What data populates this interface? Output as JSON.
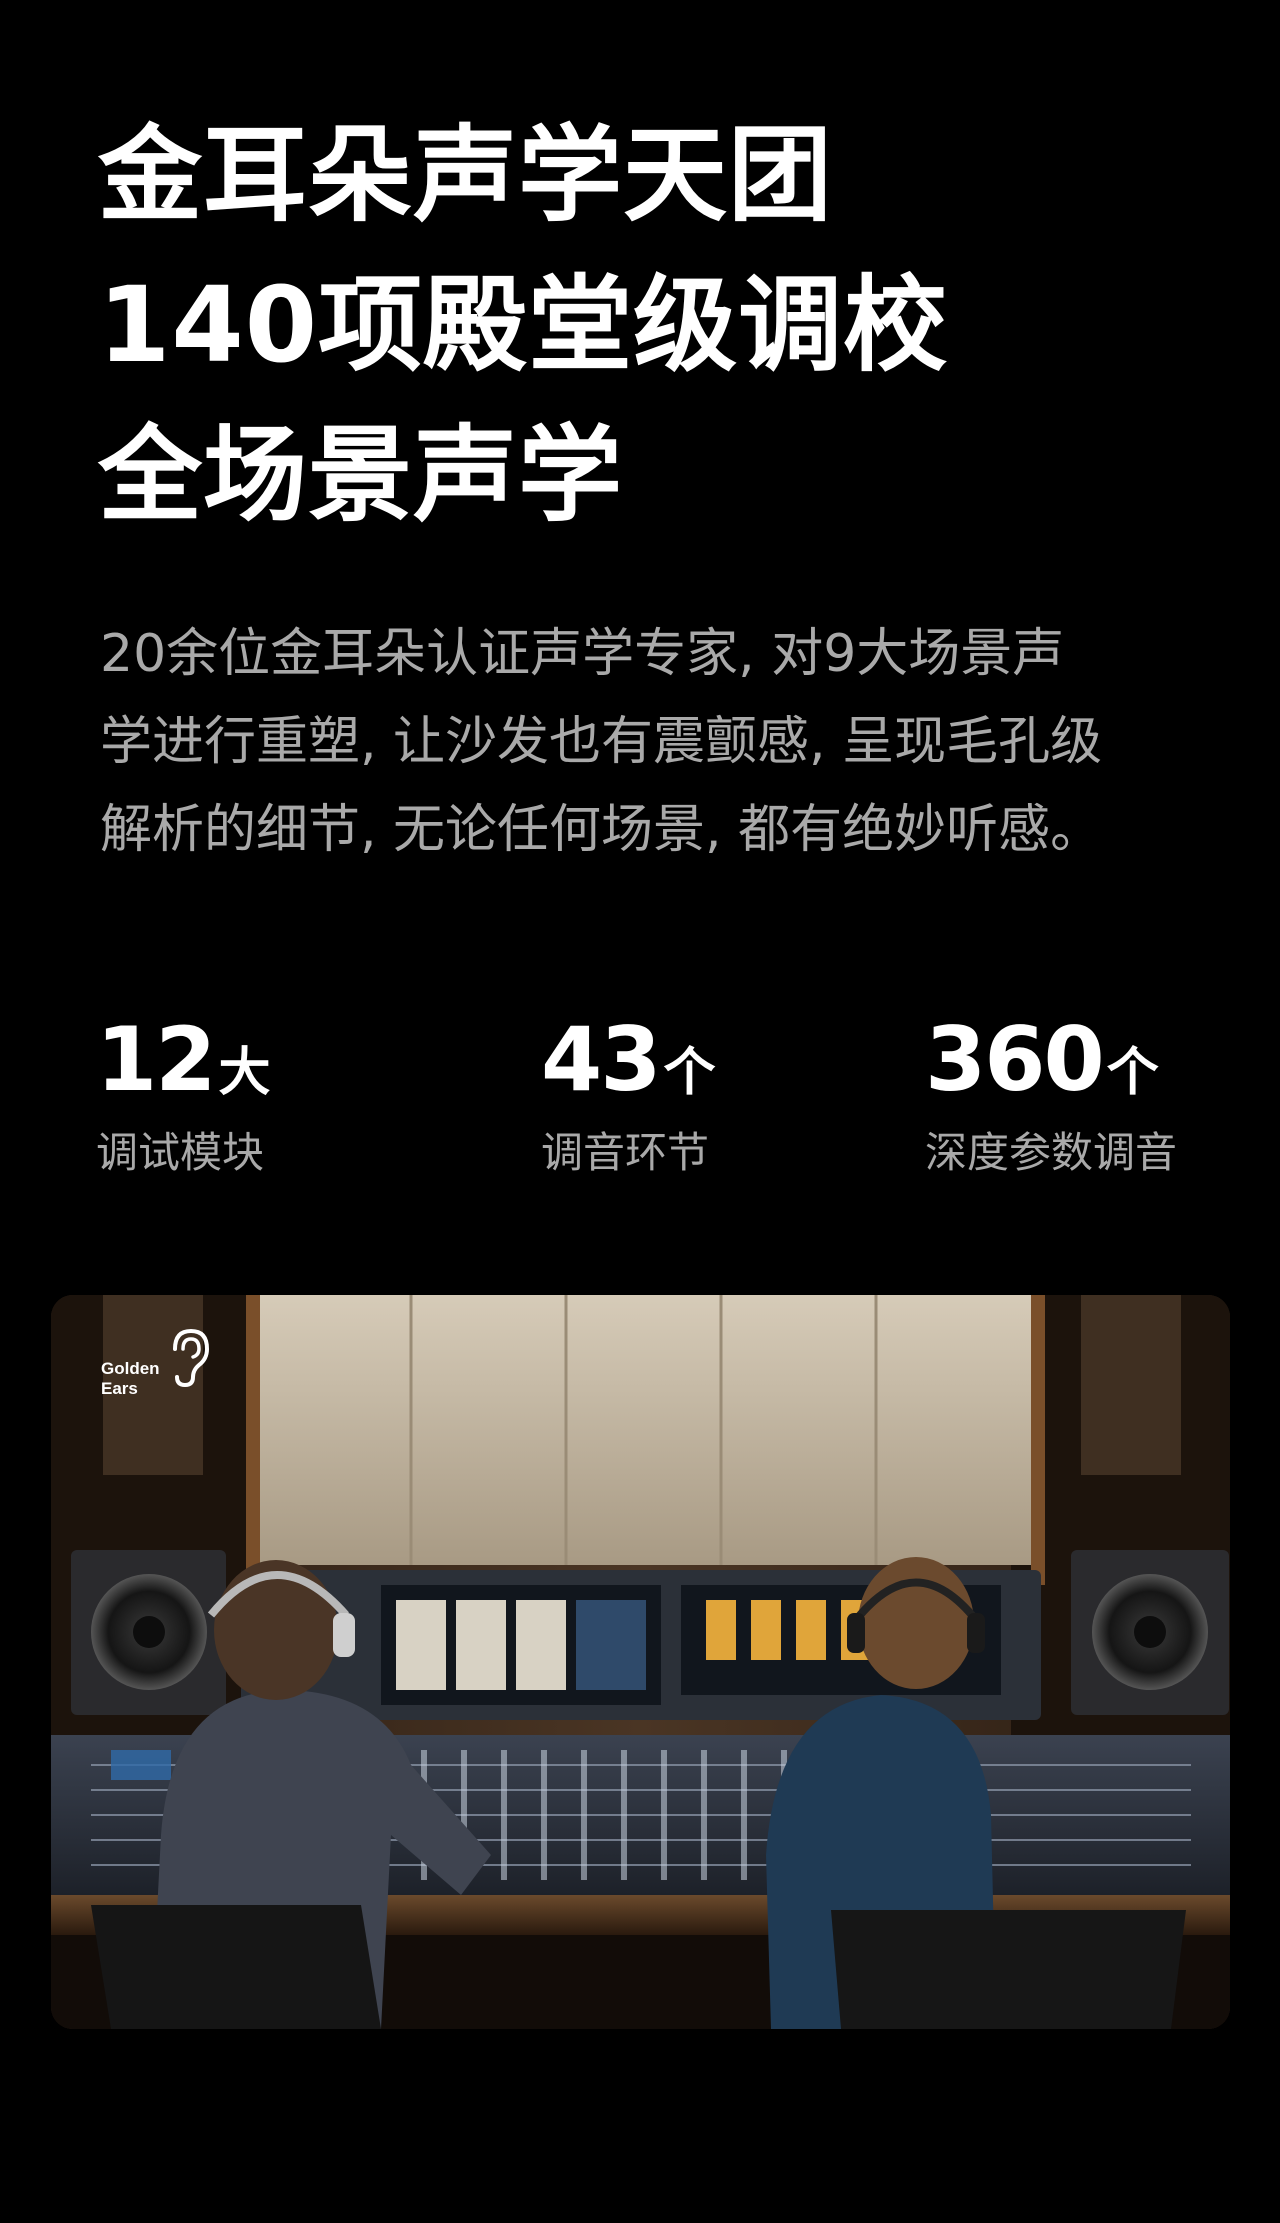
{
  "hero": {
    "title_lines": [
      "金耳朵声学天团",
      "140项殿堂级调校",
      "全场景声学"
    ],
    "description_lines": [
      "20余位金耳朵认证声学专家, 对9大场景声",
      "学进行重塑, 让沙发也有震颤感, 呈现毛孔级",
      "解析的细节, 无论任何场景, 都有绝妙听感。"
    ]
  },
  "stats": [
    {
      "value": "12",
      "unit": "大",
      "label": "调试模块"
    },
    {
      "value": "43",
      "unit": "个",
      "label": "调音环节"
    },
    {
      "value": "360",
      "unit": "个",
      "label": "深度参数调音"
    }
  ],
  "image": {
    "logo_text": [
      "Golden",
      "Ears"
    ],
    "logo_icon": "ear-icon"
  },
  "colors": {
    "background": "#000000",
    "text_primary": "#ffffff",
    "text_secondary": "#a9a9a9"
  }
}
